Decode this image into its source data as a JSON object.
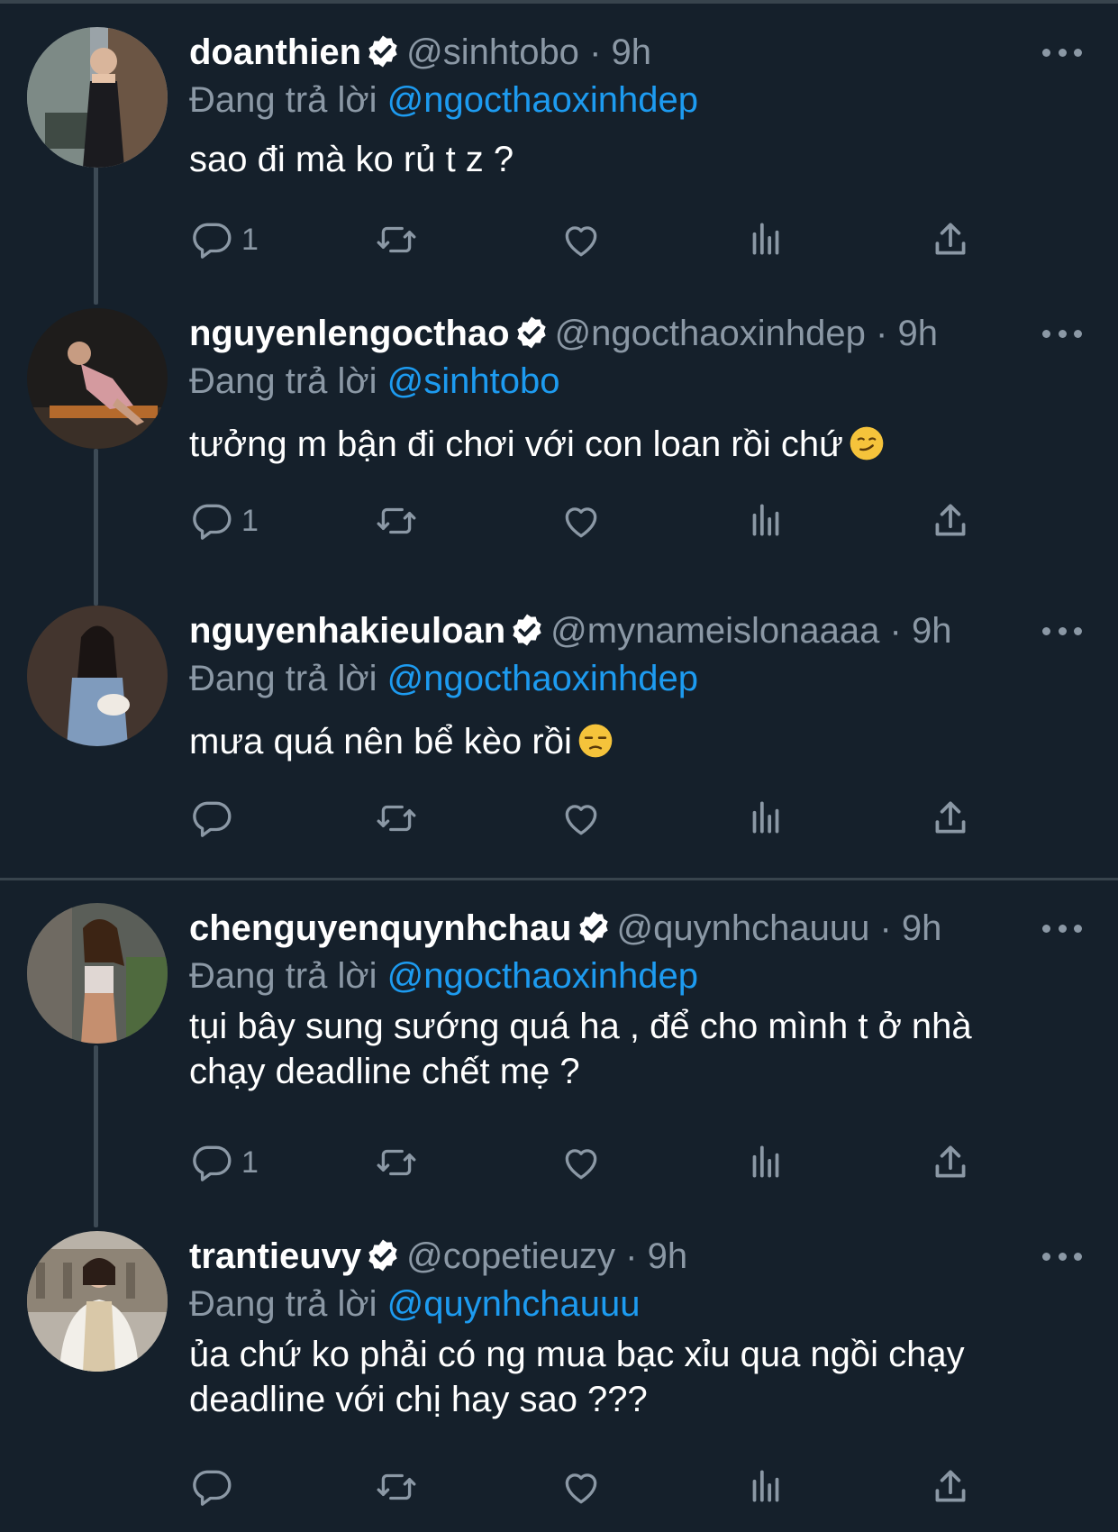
{
  "tweets": [
    {
      "name": "doanthien",
      "handle": "@sinhtobo",
      "time": "9h",
      "sep": "·",
      "reply_label": "Đang trả lời",
      "reply_mention": "@ngocthaoxinhdep",
      "text_lines": [
        "sao đi mà ko rủ t z ?"
      ],
      "emoji": "",
      "reply_count": "1"
    },
    {
      "name": "nguyenlengocthao",
      "handle": "@ngocthaoxinhdep",
      "time": "9h",
      "sep": "·",
      "reply_label": "Đang trả lời",
      "reply_mention": "@sinhtobo",
      "text_lines": [
        "tưởng m bận đi chơi với con loan rồi chứ"
      ],
      "emoji": "smirk-emoji",
      "reply_count": "1"
    },
    {
      "name": "nguyenhakieuloan",
      "handle": "@mynameislonaaaa",
      "time": "9h",
      "sep": "·",
      "reply_label": "Đang trả lời",
      "reply_mention": "@ngocthaoxinhdep",
      "text_lines": [
        "mưa quá nên bể kèo rồi"
      ],
      "emoji": "unamused-emoji",
      "reply_count": ""
    },
    {
      "name": "chenguyenquynhchau",
      "handle": "@quynhchauuu",
      "time": "9h",
      "sep": "·",
      "reply_label": "Đang trả lời",
      "reply_mention": "@ngocthaoxinhdep",
      "text_lines": [
        "tụi bây sung sướng quá ha , để cho mình t ở nhà",
        "chạy deadline chết mẹ ?"
      ],
      "emoji": "",
      "reply_count": "1"
    },
    {
      "name": "trantieuvy",
      "handle": "@copetieuzy",
      "time": "9h",
      "sep": "·",
      "reply_label": "Đang trả lời",
      "reply_mention": "@quynhchauuu",
      "text_lines": [
        "ủa chứ ko phải có ng mua bạc xỉu qua ngồi chạy",
        "deadline với chị hay sao ???"
      ],
      "emoji": "",
      "reply_count": ""
    }
  ],
  "icons": {
    "verified": "verified-badge-icon",
    "more": "more-options-icon",
    "reply": "reply-icon",
    "retweet": "retweet-icon",
    "like": "like-icon",
    "views": "views-icon",
    "share": "share-icon"
  },
  "colors": {
    "background": "#15202b",
    "text": "#ffffff",
    "muted": "#8b98a5",
    "link": "#1d9bf0",
    "divider": "#38444d"
  }
}
